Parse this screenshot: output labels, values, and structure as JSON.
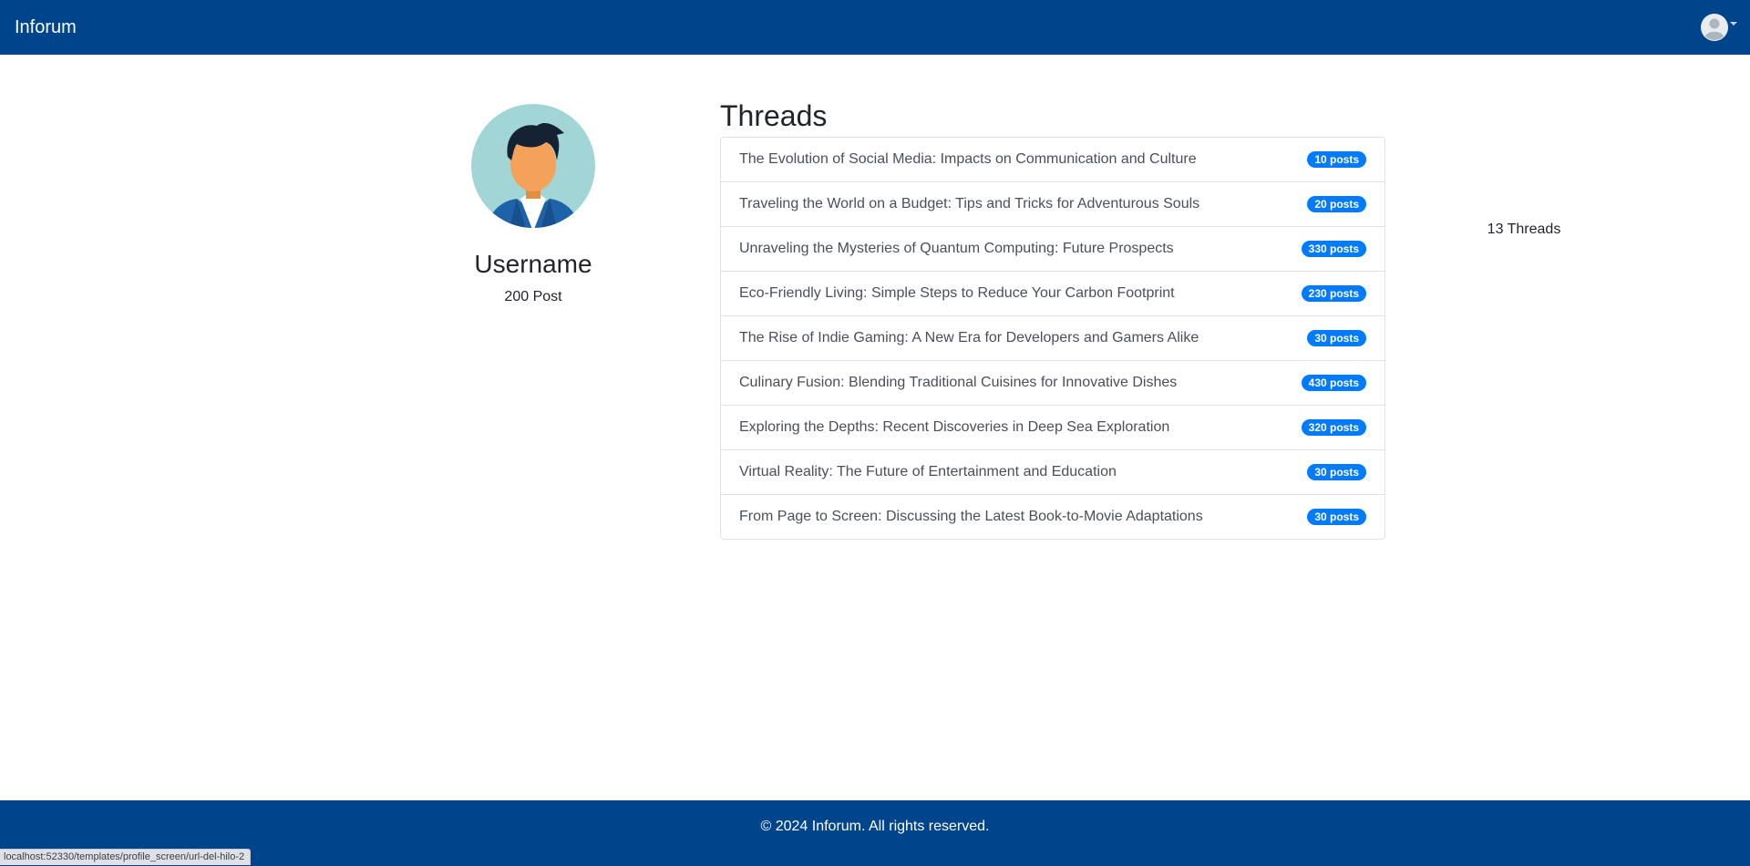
{
  "navbar": {
    "brand": "Inforum",
    "user_avatar_icon": "user-circle-icon"
  },
  "profile": {
    "avatar_icon": "person-avatar-icon",
    "username": "Username",
    "posts": "200 Post",
    "threads": "13 Threads"
  },
  "threads_section": {
    "heading": "Threads",
    "items": [
      {
        "title": "The Evolution of Social Media: Impacts on Communication and Culture",
        "count": "10 posts"
      },
      {
        "title": "Traveling the World on a Budget: Tips and Tricks for Adventurous Souls",
        "count": "20 posts"
      },
      {
        "title": "Unraveling the Mysteries of Quantum Computing: Future Prospects",
        "count": "330 posts"
      },
      {
        "title": "Eco-Friendly Living: Simple Steps to Reduce Your Carbon Footprint",
        "count": "230 posts"
      },
      {
        "title": "The Rise of Indie Gaming: A New Era for Developers and Gamers Alike",
        "count": "30 posts"
      },
      {
        "title": "Culinary Fusion: Blending Traditional Cuisines for Innovative Dishes",
        "count": "430 posts"
      },
      {
        "title": "Exploring the Depths: Recent Discoveries in Deep Sea Exploration",
        "count": "320 posts"
      },
      {
        "title": "Virtual Reality: The Future of Entertainment and Education",
        "count": "30 posts"
      },
      {
        "title": "From Page to Screen: Discussing the Latest Book-to-Movie Adaptations",
        "count": "30 posts"
      }
    ]
  },
  "footer": {
    "text": "© 2024 Inforum. All rights reserved."
  },
  "status_bar": {
    "url": "localhost:52330/templates/profile_screen/url-del-hilo-2"
  },
  "colors": {
    "navbar_bg": "#00448b",
    "badge_bg": "#007bff"
  }
}
